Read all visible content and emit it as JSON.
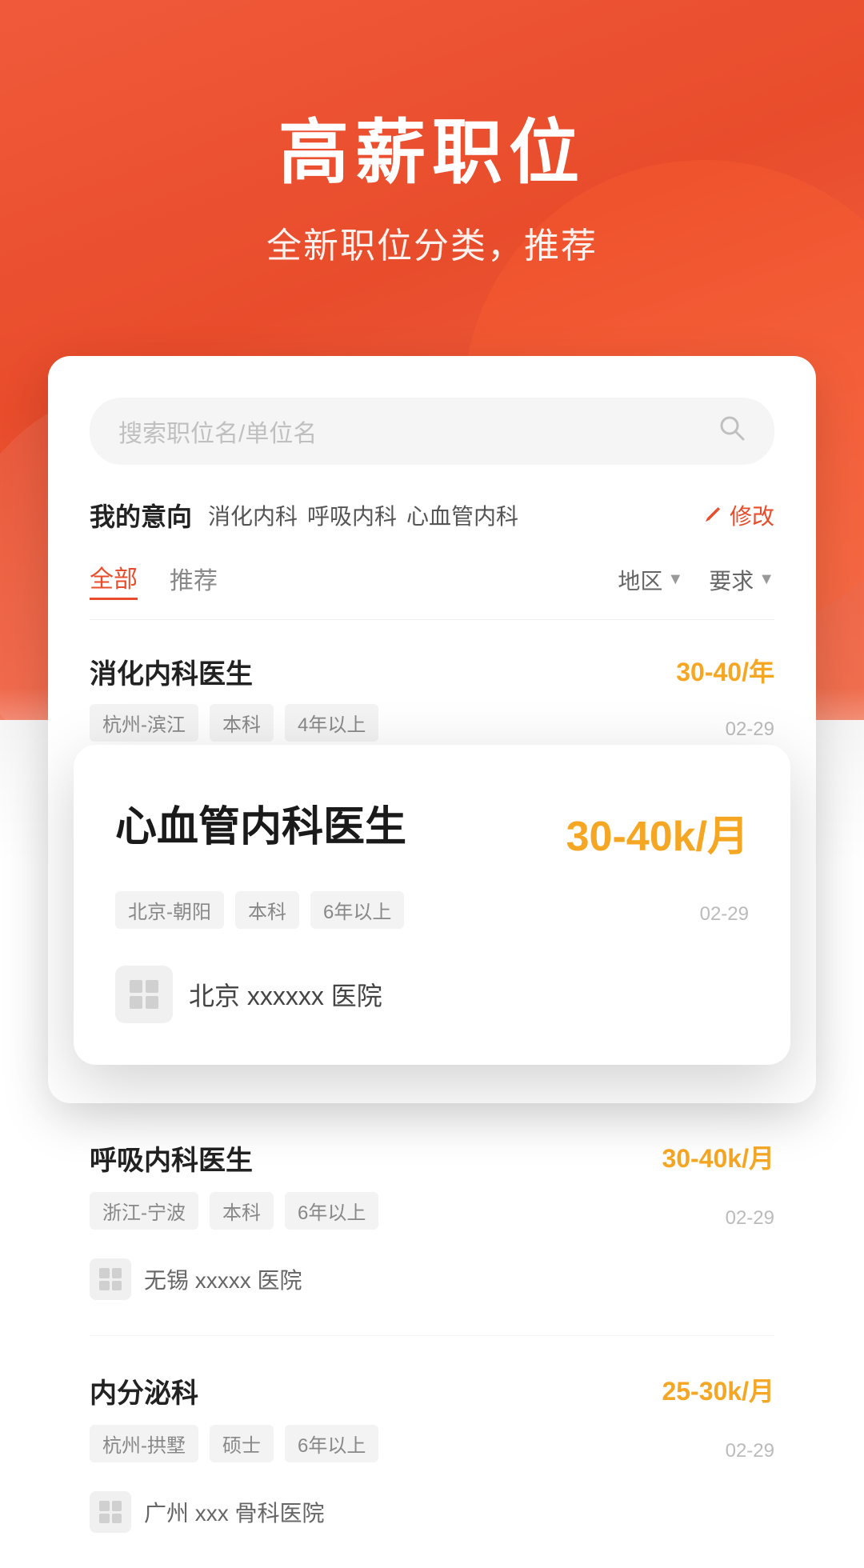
{
  "hero": {
    "title": "高薪职位",
    "subtitle": "全新职位分类，推荐"
  },
  "search": {
    "placeholder": "搜索职位名/单位名"
  },
  "intent": {
    "label": "我的意向",
    "tags": [
      "消化内科",
      "呼吸内科",
      "心血管内科"
    ],
    "edit_label": "修改"
  },
  "filters": {
    "tabs": [
      "全部",
      "推荐"
    ],
    "active_tab": "全部",
    "right_filters": [
      "地区",
      "要求"
    ]
  },
  "top_job": {
    "title": "消化内科医生",
    "salary": "30-40/年",
    "tags": [
      "杭州-滨江",
      "本科",
      "4年以上"
    ],
    "date": "02-29"
  },
  "popup_job": {
    "title": "心血管内科医生",
    "salary": "30-40k/月",
    "tags": [
      "北京-朝阳",
      "本科",
      "6年以上"
    ],
    "date": "02-29",
    "company_name": "北京 xxxxxx 医院"
  },
  "job_list": [
    {
      "title": "呼吸内科医生",
      "salary": "30-40k/月",
      "tags": [
        "浙江-宁波",
        "本科",
        "6年以上"
      ],
      "date": "02-29",
      "company": "无锡 xxxxx 医院"
    },
    {
      "title": "内分泌科",
      "salary": "25-30k/月",
      "tags": [
        "杭州-拱墅",
        "硕士",
        "6年以上"
      ],
      "date": "02-29",
      "company": "广州 xxx 骨科医院"
    }
  ]
}
